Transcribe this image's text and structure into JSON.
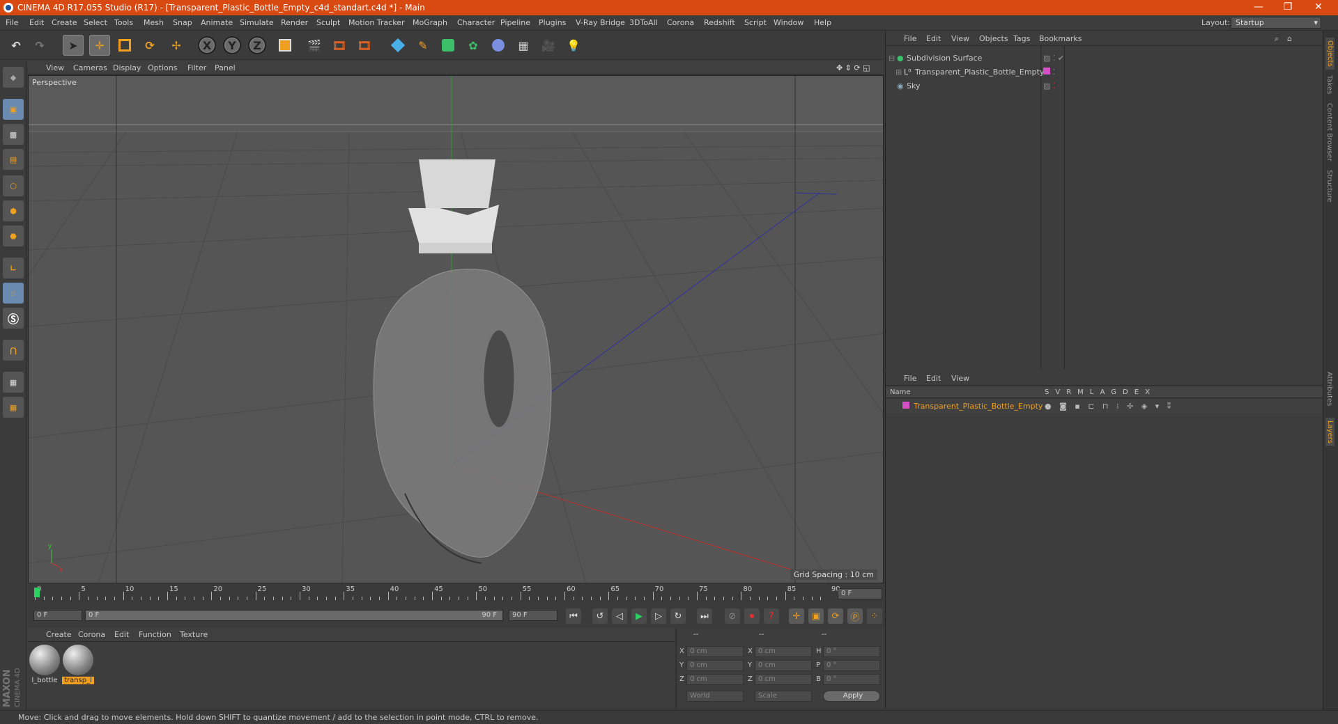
{
  "window": {
    "title": "CINEMA 4D R17.055 Studio (R17) - [Transparent_Plastic_Bottle_Empty_c4d_standart.c4d *] - Main",
    "minimize": "—",
    "restore": "❐",
    "close": "✕"
  },
  "menu": [
    "File",
    "Edit",
    "Create",
    "Select",
    "Tools",
    "Mesh",
    "Snap",
    "Animate",
    "Simulate",
    "Render",
    "Sculpt",
    "Motion Tracker",
    "MoGraph",
    "Character",
    "Pipeline",
    "Plugins",
    "V-Ray Bridge",
    "3DToAll",
    "Corona",
    "Redshift",
    "Script",
    "Window",
    "Help"
  ],
  "layout": {
    "label": "Layout:",
    "value": "Startup"
  },
  "toolbar": {
    "x": "X",
    "y": "Y",
    "z": "Z"
  },
  "viewport": {
    "menu": [
      "View",
      "Cameras",
      "Display",
      "Options",
      "Filter",
      "Panel"
    ],
    "label": "Perspective",
    "grid_spacing": "Grid Spacing : 10 cm"
  },
  "timeline": {
    "ticks": [
      "0",
      "5",
      "10",
      "15",
      "20",
      "25",
      "30",
      "35",
      "40",
      "45",
      "50",
      "55",
      "60",
      "65",
      "70",
      "75",
      "80",
      "85",
      "90"
    ],
    "current": "0 F",
    "start": "0 F",
    "range_start": "0 F",
    "range_end": "90 F",
    "end": "90 F"
  },
  "materials": {
    "menu": [
      "Create",
      "Corona",
      "Edit",
      "Function",
      "Texture"
    ],
    "items": [
      {
        "label": "l_bottle"
      },
      {
        "label": "transp_l"
      }
    ]
  },
  "coords": {
    "header": [
      "--",
      "--",
      "--"
    ],
    "rows": [
      {
        "a": "X",
        "av": "0 cm",
        "b": "X",
        "bv": "0 cm",
        "c": "H",
        "cv": "0 °"
      },
      {
        "a": "Y",
        "av": "0 cm",
        "b": "Y",
        "bv": "0 cm",
        "c": "P",
        "cv": "0 °"
      },
      {
        "a": "Z",
        "av": "0 cm",
        "b": "Z",
        "bv": "0 cm",
        "c": "B",
        "cv": "0 °"
      }
    ],
    "world": "World",
    "scale": "Scale",
    "apply": "Apply"
  },
  "objects": {
    "menu": [
      "File",
      "Edit",
      "View",
      "Objects",
      "Tags",
      "Bookmarks"
    ],
    "items": [
      {
        "name": "Subdivision Surface"
      },
      {
        "name": "Transparent_Plastic_Bottle_Empty"
      },
      {
        "name": "Sky"
      }
    ]
  },
  "layers": {
    "menu": [
      "File",
      "Edit",
      "View"
    ],
    "header_name": "Name",
    "cols": [
      "S",
      "V",
      "R",
      "M",
      "L",
      "A",
      "G",
      "D",
      "E",
      "X"
    ],
    "items": [
      {
        "name": "Transparent_Plastic_Bottle_Empty",
        "color": "#d64fc4"
      }
    ]
  },
  "right_tabs": [
    "Objects",
    "Takes",
    "Content Browser",
    "Structure",
    "Attributes",
    "Layers"
  ],
  "status": "Move: Click and drag to move elements. Hold down SHIFT to quantize movement / add to the selection in point mode, CTRL to remove.",
  "brand": {
    "maxon": "MAXON",
    "c4d": "CINEMA 4D"
  },
  "colors": {
    "accent": "#d94a12",
    "highlight": "#f0a020"
  }
}
